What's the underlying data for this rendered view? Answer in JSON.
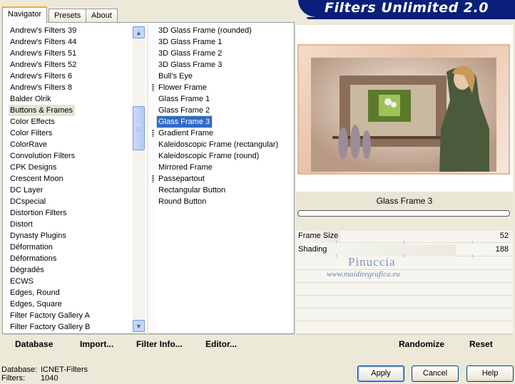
{
  "tabs": [
    {
      "label": "Navigator",
      "active": true
    },
    {
      "label": "Presets",
      "active": false
    },
    {
      "label": "About",
      "active": false
    }
  ],
  "banner": {
    "title": "Filters Unlimited 2.0"
  },
  "categories": [
    "Andrew's Filters 39",
    "Andrew's Filters 44",
    "Andrew's Filters 51",
    "Andrew's Filters 52",
    "Andrew's Filters 6",
    "Andrew's Filters 8",
    "Balder Olrik",
    "Buttons & Frames",
    "Color Effects",
    "Color Filters",
    "ColorRave",
    "Convolution Filters",
    "CPK Designs",
    "Crescent Moon",
    "DC Layer",
    "DCspecial",
    "Distortion Filters",
    "Distort",
    "Dynasty Plugins",
    "Déformation",
    "Déformations",
    "Dégradés",
    "ECWS",
    "Edges, Round",
    "Edges, Square",
    "Filter Factory Gallery A",
    "Filter Factory Gallery B"
  ],
  "selected_category": "Buttons & Frames",
  "filters": [
    {
      "label": "3D Glass Frame (rounded)",
      "grip": false
    },
    {
      "label": "3D Glass Frame 1",
      "grip": false
    },
    {
      "label": "3D Glass Frame 2",
      "grip": false
    },
    {
      "label": "3D Glass Frame 3",
      "grip": false
    },
    {
      "label": "Bull's Eye",
      "grip": false
    },
    {
      "label": "Flower Frame",
      "grip": true
    },
    {
      "label": "Glass Frame 1",
      "grip": false
    },
    {
      "label": "Glass Frame 2",
      "grip": false
    },
    {
      "label": "Glass Frame 3",
      "grip": false
    },
    {
      "label": "Gradient Frame",
      "grip": true
    },
    {
      "label": "Kaleidoscopic Frame (rectangular)",
      "grip": false
    },
    {
      "label": "Kaleidoscopic Frame (round)",
      "grip": false
    },
    {
      "label": "Mirrored Frame",
      "grip": false
    },
    {
      "label": "Passepartout",
      "grip": true
    },
    {
      "label": "Rectangular Button",
      "grip": false
    },
    {
      "label": "Round Button",
      "grip": false
    }
  ],
  "selected_filter": "Glass Frame 3",
  "left_buttons": {
    "database": "Database",
    "import": "Import...",
    "filter_info": "Filter Info...",
    "editor": "Editor..."
  },
  "preview": {
    "filter_name": "Glass Frame 3",
    "progress": 0
  },
  "params": [
    {
      "label": "Frame Size",
      "value": 52,
      "max": 255
    },
    {
      "label": "Shading",
      "value": 188,
      "max": 255
    }
  ],
  "watermark": {
    "name": "Pinuccia",
    "url": "www.maidiregrafica.eu"
  },
  "right_buttons": {
    "randomize": "Randomize",
    "reset": "Reset"
  },
  "footer": {
    "database_label": "Database:",
    "database_value": "ICNET-Filters",
    "filters_label": "Filters:",
    "filters_value": "1040"
  },
  "dialog_buttons": {
    "apply": "Apply",
    "cancel": "Cancel",
    "help": "Help"
  },
  "colors": {
    "banner": "#0b1f7a",
    "selection": "#316ac5",
    "tab_accent": "#f2a83a"
  }
}
